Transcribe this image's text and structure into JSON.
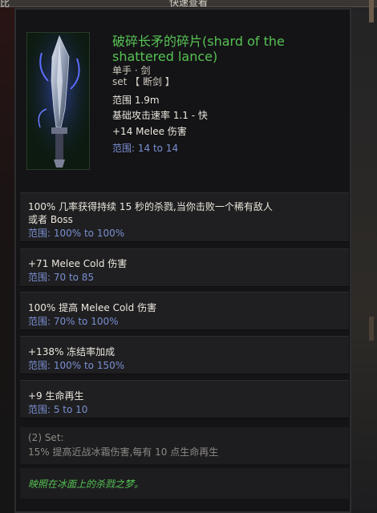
{
  "top": {
    "left_fragment": "比",
    "title": "快速查看"
  },
  "item": {
    "name": "破碎长矛的碎片(shard of the shattered lance)",
    "type": "单手 · 剑",
    "set": "set 【 断剑 】",
    "stats": [
      {
        "text": "范围 1.9m",
        "kind": "stat"
      },
      {
        "text": "基础攻击速率 1.1 - 快",
        "kind": "stat"
      },
      {
        "text": "+14 Melee 伤害",
        "kind": "stat"
      },
      {
        "text": "范围: 14 to 14",
        "kind": "range"
      }
    ]
  },
  "affixes": [
    {
      "lines": [
        "100% 几率获得持续 15 秒的杀戮,当你击败一个稀有敌人",
        "或者 Boss"
      ],
      "range": "范围: 100% to 100%"
    },
    {
      "lines": [
        "+71 Melee Cold 伤害"
      ],
      "range": "范围: 70 to 85"
    },
    {
      "lines": [
        "100% 提高 Melee Cold 伤害"
      ],
      "range": "范围: 70% to 100%"
    },
    {
      "lines": [
        "+138% 冻结率加成"
      ],
      "range": "范围: 100% to 150%"
    },
    {
      "lines": [
        "+9 生命再生"
      ],
      "range": "范围: 5 to 10"
    }
  ],
  "set_bonus": {
    "header": "(2) Set:",
    "text": "15% 提高近战冰霜伤害,每有 10 点生命再生"
  },
  "flavor_text": "映照在冰面上的杀戮之梦。",
  "colors": {
    "item_name": "#56c254",
    "range": "#7a8fd1",
    "set_bonus": "#8c8a86"
  }
}
